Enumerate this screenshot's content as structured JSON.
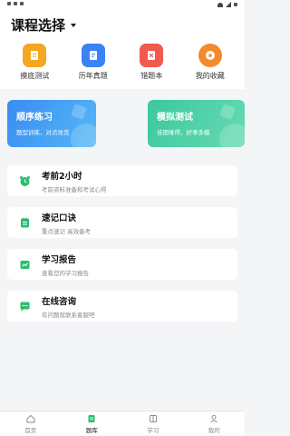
{
  "status_bar": {
    "time": "",
    "icons": [
      "notification-icon",
      "wifi-icon",
      "signal-icon",
      "battery-icon"
    ]
  },
  "header": {
    "title": "课程选择"
  },
  "quick_actions": [
    {
      "label": "摸底测试",
      "icon": "clipboard-icon",
      "color": "#f5a623"
    },
    {
      "label": "历年真题",
      "icon": "document-icon",
      "color": "#3b82f6"
    },
    {
      "label": "错题本",
      "icon": "wrong-book-icon",
      "color": "#f05a4f"
    },
    {
      "label": "我的收藏",
      "icon": "star-icon",
      "color": "#f58a2a"
    }
  ],
  "practice_cards": [
    {
      "title": "顺序练习",
      "subtitle": "题型训练，对点攻克",
      "color": "#3a8cf2"
    },
    {
      "title": "模拟测试",
      "subtitle": "佳期难得，好事多模",
      "color": "#3cc89c"
    }
  ],
  "features": [
    {
      "title": "考前2小时",
      "subtitle": "考前资料准备和考试心得",
      "icon": "alarm-clock-icon",
      "color": "#2bbd6e"
    },
    {
      "title": "速记口诀",
      "subtitle": "重点速记 高效备考",
      "icon": "notebook-icon",
      "color": "#2bbd6e"
    },
    {
      "title": "学习报告",
      "subtitle": "查看您的学习报告",
      "icon": "chart-icon",
      "color": "#2bbd6e"
    },
    {
      "title": "在线咨询",
      "subtitle": "有问题就联系客服吧",
      "icon": "chat-icon",
      "color": "#2bbd6e"
    }
  ],
  "tabs": [
    {
      "label": "首页",
      "icon": "home-icon",
      "active": false
    },
    {
      "label": "题库",
      "icon": "question-bank-icon",
      "active": true
    },
    {
      "label": "学习",
      "icon": "book-icon",
      "active": false
    },
    {
      "label": "我的",
      "icon": "profile-icon",
      "active": false
    }
  ],
  "colors": {
    "brand_green": "#2bbd6e",
    "background": "#f4f5f7"
  }
}
